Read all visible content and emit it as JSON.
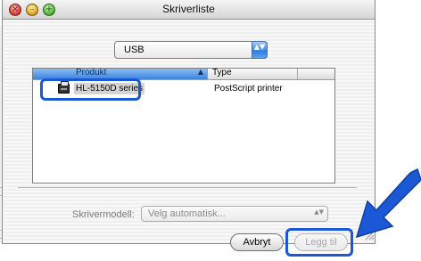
{
  "window": {
    "title": "Skriverliste",
    "controls": {
      "close_glyph": "×",
      "minimize_glyph": "–",
      "zoom_glyph": "+"
    }
  },
  "connection_popup": {
    "value": "USB",
    "arrows": "▲▼"
  },
  "printer_list": {
    "columns": [
      {
        "label": "Produkt",
        "sorted": true,
        "sort_glyph": "▲"
      },
      {
        "label": "Type"
      }
    ],
    "rows": [
      {
        "icon": "printer-icon",
        "product": "HL-5150D series",
        "type": "PostScript printer"
      }
    ]
  },
  "printer_model": {
    "label": "Skrivermodell:",
    "value": "Velg automatisk...",
    "arrows": "▲▼"
  },
  "buttons": {
    "cancel": "Avbryt",
    "add": "Legg til"
  },
  "colors": {
    "highlight": "#1b58d6",
    "pointer_arrow": "#1b58d6",
    "column_selected": "#5d9ae8"
  }
}
